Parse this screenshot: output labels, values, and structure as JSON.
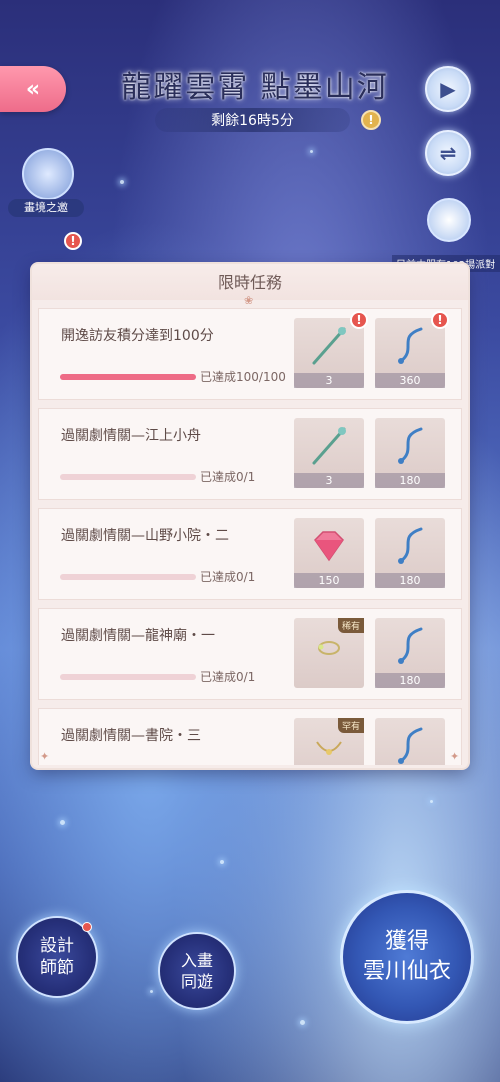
{
  "header": {
    "title": "龍躍雲霄 點墨山河",
    "timer": "剩餘16時5分",
    "back_icon": "double-chevron-left",
    "alert_glyph": "!",
    "warn_glyph": "!"
  },
  "left_panel": {
    "realm_label": "畫境之邀"
  },
  "right_panel": {
    "play_icon": "▶",
    "swap_icon": "⇌",
    "caption": "目前本服有102場派對"
  },
  "task_panel": {
    "title": "限時任務",
    "tasks": [
      {
        "name": "開逸訪友積分達到100分",
        "progress_text": "已達成100/100",
        "progress": 1.0,
        "rewards": [
          {
            "qty": "3",
            "alert": "!"
          },
          {
            "qty": "360",
            "alert": "!"
          }
        ]
      },
      {
        "name": "過關劇情關—江上小舟",
        "progress_text": "已達成0/1",
        "progress": 0,
        "rewards": [
          {
            "qty": "3"
          },
          {
            "qty": "180"
          }
        ]
      },
      {
        "name": "過關劇情關—山野小院・二",
        "progress_text": "已達成0/1",
        "progress": 0,
        "rewards": [
          {
            "qty": "150"
          },
          {
            "qty": "180"
          }
        ]
      },
      {
        "name": "過關劇情關—龍神廟・一",
        "progress_text": "已達成0/1",
        "progress": 0,
        "rewards": [
          {
            "qty": "",
            "tag": "稀有"
          },
          {
            "qty": "180"
          }
        ]
      },
      {
        "name": "過關劇情關—書院・三",
        "progress_text": "",
        "progress": 0,
        "rewards": [
          {
            "qty": "",
            "tag": "罕有"
          },
          {
            "qty": ""
          }
        ]
      }
    ]
  },
  "bottom": {
    "design_btn": "設計\n師節",
    "tour_btn": "入畫\n同遊",
    "obtain_btn": "獲得\n雲川仙衣"
  },
  "colors": {
    "accent_pink": "#ee6b86",
    "panel_bg": "#f6ecea",
    "alert_red": "#e6564f"
  }
}
